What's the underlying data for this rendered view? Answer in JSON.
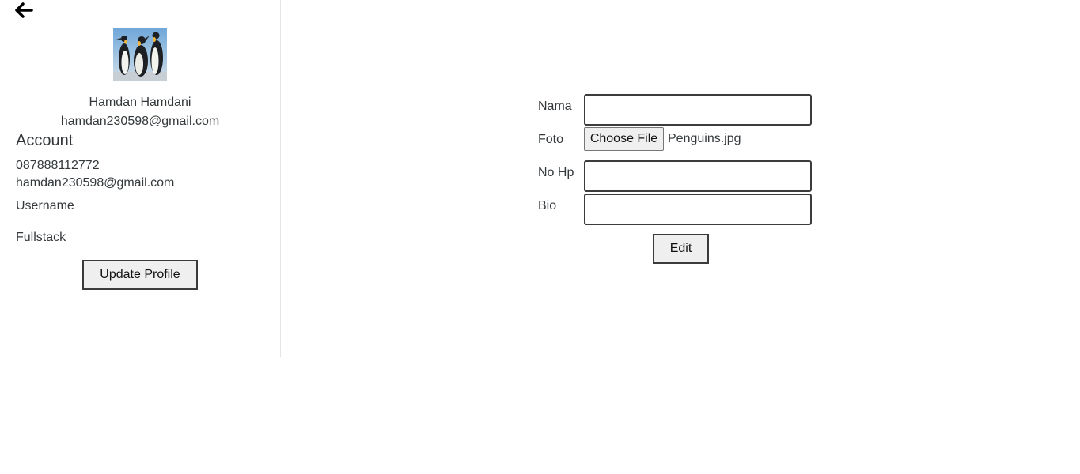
{
  "navigation": {
    "back_icon": "arrow-left-icon"
  },
  "profile": {
    "avatar": "penguins-photo",
    "name": "Hamdan Hamdani",
    "email": "hamdan230598@gmail.com"
  },
  "account": {
    "heading": "Account",
    "phone": "087888112772",
    "email": "hamdan230598@gmail.com",
    "username": "Username",
    "role": "Fullstack",
    "update_button": "Update Profile"
  },
  "form": {
    "nama_label": "Nama",
    "nama_value": "",
    "foto_label": "Foto",
    "foto_button": "Choose File",
    "foto_filename": "Penguins.jpg",
    "nohp_label": "No Hp",
    "nohp_value": "",
    "bio_label": "Bio",
    "bio_value": "",
    "edit_button": "Edit"
  }
}
